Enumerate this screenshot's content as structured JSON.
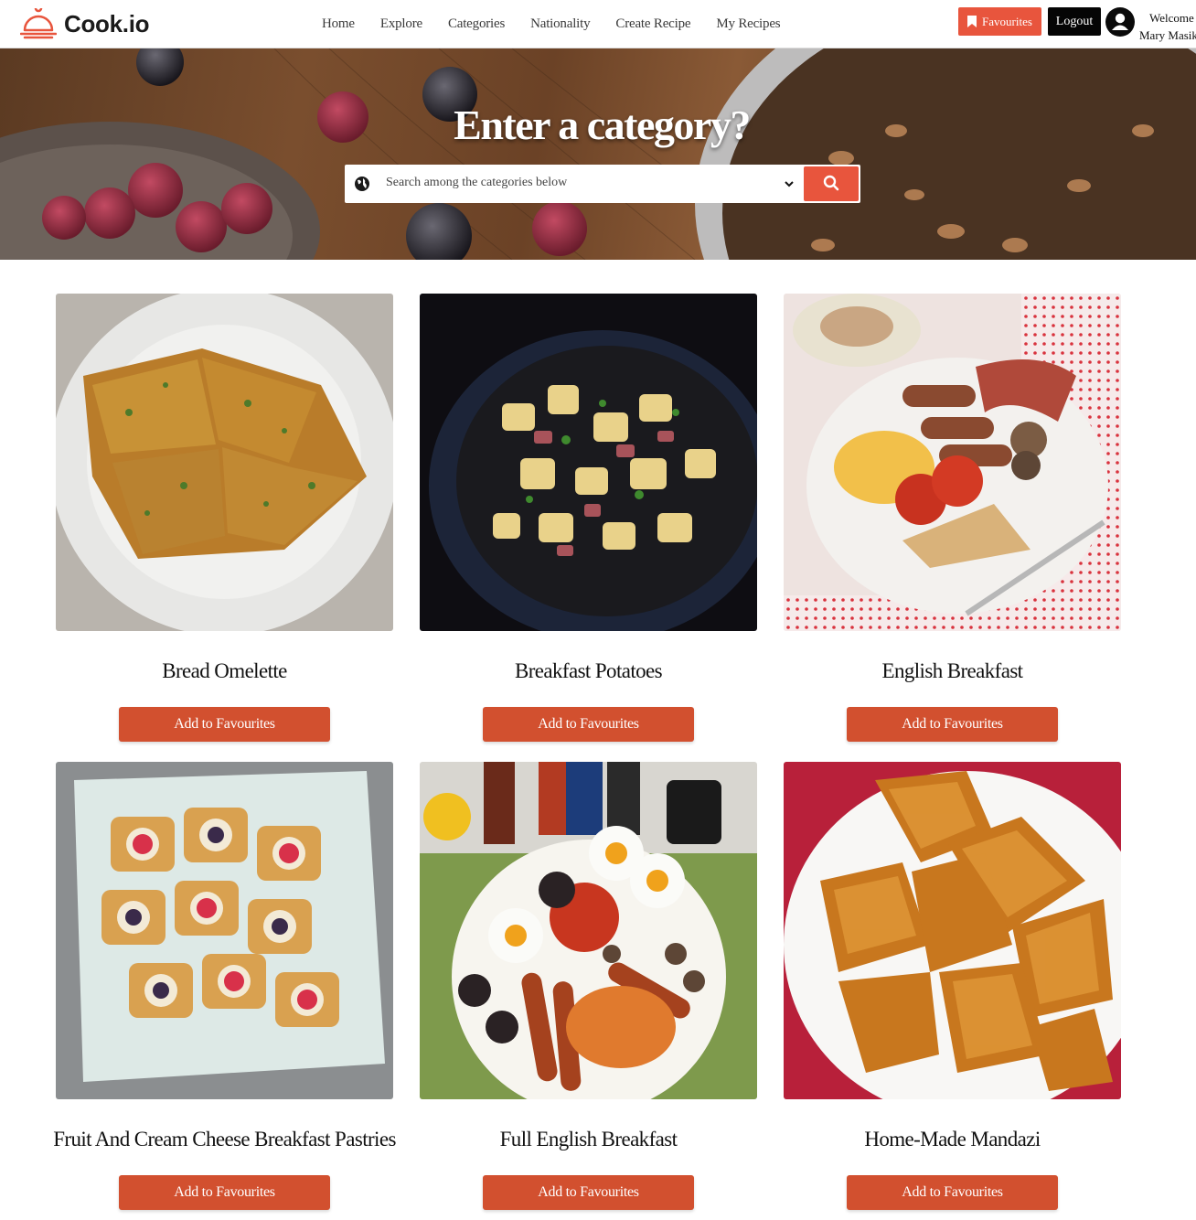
{
  "app": {
    "brand": "Cook.io"
  },
  "nav": {
    "links": [
      "Home",
      "Explore",
      "Categories",
      "Nationality",
      "Create Recipe",
      "My Recipes"
    ],
    "favourites_label": "Favourites",
    "logout_label": "Logout",
    "welcome_line1": "Welcome",
    "welcome_line2": "Mary Masika"
  },
  "hero": {
    "title": "Enter a category?",
    "search_placeholder": "Search among the categories below"
  },
  "recipes": [
    {
      "title": "Bread Omelette",
      "button": "Add to Favourites"
    },
    {
      "title": "Breakfast Potatoes",
      "button": "Add to Favourites"
    },
    {
      "title": "English Breakfast",
      "button": "Add to Favourites"
    },
    {
      "title": "Fruit And Cream Cheese Breakfast Pastries",
      "button": "Add to Favourites"
    },
    {
      "title": "Full English Breakfast",
      "button": "Add to Favourites"
    },
    {
      "title": "Home-Made Mandazi",
      "button": "Add to Favourites"
    }
  ],
  "colors": {
    "accent": "#e8553d",
    "button": "#d2502f",
    "dark": "#050505"
  }
}
